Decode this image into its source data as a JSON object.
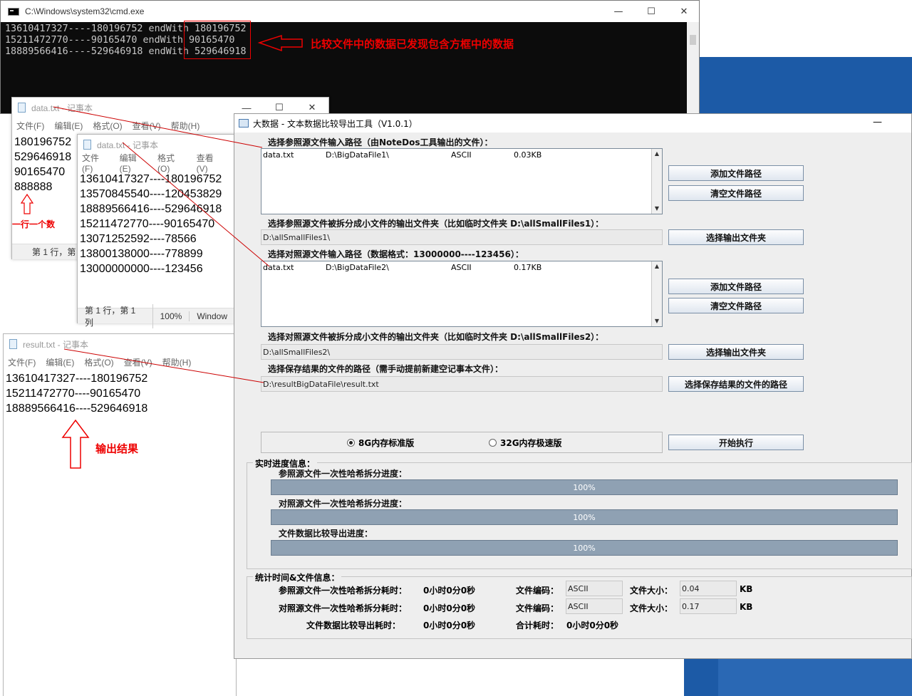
{
  "cmd": {
    "title": "C:\\Windows\\system32\\cmd.exe",
    "lines": [
      "13610417327----180196752 endWith 180196752",
      "15211472770----90165470 endWith 90165470",
      "18889566416----529646918 endWith 529646918"
    ],
    "annotation": "比较文件中的数据已发现包含方框中的数据"
  },
  "notepad1": {
    "title": "data.txt - 记事本",
    "menu": [
      "文件(F)",
      "编辑(E)",
      "格式(O)",
      "查看(V)",
      "帮助(H)"
    ],
    "lines": [
      "180196752",
      "529646918",
      "90165470",
      "888888"
    ],
    "status": "第 1 行，第",
    "annotation": "一行一个数"
  },
  "notepad2": {
    "title": "data.txt - 记事本",
    "menu": [
      "文件(F)",
      "编辑(E)",
      "格式(O)",
      "查看(V)"
    ],
    "lines": [
      "13610417327----180196752",
      "13570845540----120453829",
      "18889566416----529646918",
      "15211472770----90165470",
      "13071252592----78566",
      "13800138000----778899",
      "13000000000----123456"
    ],
    "status": [
      "第 1 行，第 1 列",
      "100%",
      "Window"
    ]
  },
  "notepad3": {
    "title": "result.txt - 记事本",
    "menu": [
      "文件(F)",
      "编辑(E)",
      "格式(O)",
      "查看(V)",
      "帮助(H)"
    ],
    "lines": [
      "13610417327----180196752",
      "15211472770----90165470",
      "18889566416----529646918"
    ],
    "annotation": "输出结果"
  },
  "tool": {
    "title": "大数据 - 文本数据比较导出工具（V1.0.1）",
    "ref_input_label": "选择参照源文件输入路径（由NoteDos工具输出的文件）：",
    "ref_list": [
      {
        "name": "data.txt",
        "path": "D:\\BigDataFile1\\",
        "enc": "ASCII",
        "size": "0.03KB"
      }
    ],
    "add_path_btn": "添加文件路径",
    "clear_path_btn": "清空文件路径",
    "ref_split_label": "选择参照源文件被拆分成小文件的输出文件夹（比如临时文件夹 D:\\allSmallFiles1）：",
    "ref_split_value": "D:\\allSmallFiles1\\",
    "choose_out_btn": "选择输出文件夹",
    "cmp_input_label": "选择对照源文件输入路径（数据格式：13000000----123456）：",
    "cmp_list": [
      {
        "name": "data.txt",
        "path": "D:\\BigDataFile2\\",
        "enc": "ASCII",
        "size": "0.17KB"
      }
    ],
    "cmp_split_label": "选择对照源文件被拆分成小文件的输出文件夹（比如临时文件夹 D:\\allSmallFiles2）：",
    "cmp_split_value": "D:\\allSmallFiles2\\",
    "result_label": "选择保存结果的文件的路径（需手动提前新建空记事本文件）：",
    "result_value": "D:\\resultBigDataFile\\result.txt",
    "result_btn": "选择保存结果的文件的路径",
    "radio_8g": "8G内存标准版",
    "radio_32g": "32G内存极速版",
    "start_btn": "开始执行",
    "progress_title": "实时进度信息：",
    "progress": [
      {
        "label": "参照源文件一次性哈希拆分进度：",
        "value": "100%",
        "fraction": 1.0
      },
      {
        "label": "对照源文件一次性哈希拆分进度：",
        "value": "100%",
        "fraction": 1.0
      },
      {
        "label": "文件数据比较导出进度：",
        "value": "100%",
        "fraction": 1.0
      }
    ],
    "stats_title": "统计时间&文件信息：",
    "stats": {
      "ref_split_label": "参照源文件一次性哈希拆分耗时：",
      "ref_split_time": "0小时0分0秒",
      "cmp_split_label": "对照源文件一次性哈希拆分耗时：",
      "cmp_split_time": "0小时0分0秒",
      "export_label": "文件数据比较导出耗时：",
      "export_time": "0小时0分0秒",
      "enc_label": "文件编码：",
      "enc1": "ASCII",
      "enc2": "ASCII",
      "size_label": "文件大小：",
      "size1": "0.04",
      "size2": "0.17",
      "unit": "KB",
      "total_label": "合计耗时：",
      "total_time": "0小时0分0秒"
    }
  }
}
